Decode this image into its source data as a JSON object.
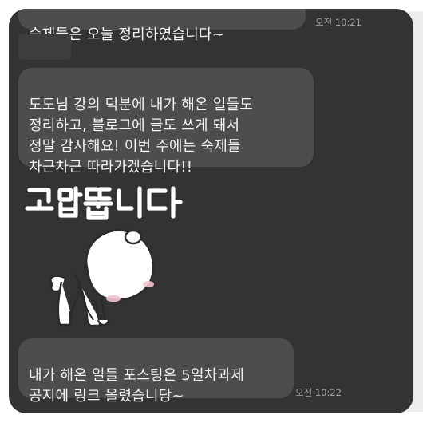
{
  "chat": {
    "messages": [
      {
        "text": "숙제들은 오늘 정리하였습니다~",
        "time": "오전 10:21"
      },
      {
        "text": "도도님 강의 덕분에 내가 해온 일들도\n정리하고, 블로그에 글도 쓰게 돼서\n정말 감사해요! 이번 주에는 숙제들\n차근차근 따라가겠습니다!!"
      },
      {
        "sticker": {
          "caption": "고맙뜹니다",
          "icon": "bowing-bear-sticker"
        }
      },
      {
        "text": "내가 해온 일들 포스팅은 5일차과제\n공지에 링크 올렸습니당~",
        "time": "오전 10:22"
      }
    ]
  },
  "colors": {
    "background": "#333335",
    "bubble": "#4d4d50",
    "text": "#f3f3f3",
    "timestamp": "#a6a6a8"
  }
}
